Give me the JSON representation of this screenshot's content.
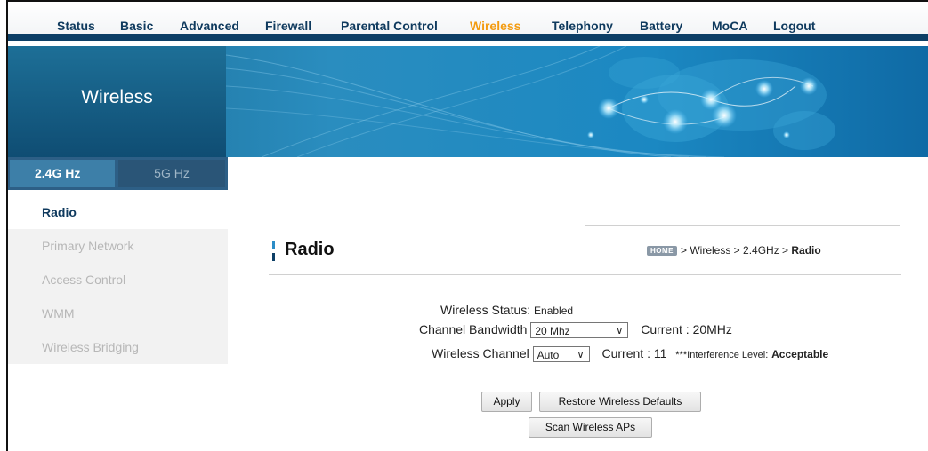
{
  "nav": {
    "items": [
      "Status",
      "Basic",
      "Advanced",
      "Firewall",
      "Parental Control",
      "Wireless",
      "Telephony",
      "Battery",
      "MoCA",
      "Logout"
    ],
    "active": "Wireless",
    "active_color": "#f39c12",
    "link_color": "#0f3a5e"
  },
  "banner": {
    "title": "Wireless"
  },
  "band_tabs": {
    "tab1": "2.4G Hz",
    "tab2": "5G Hz"
  },
  "sidebar": {
    "items": [
      {
        "label": "Radio"
      },
      {
        "label": "Primary Network"
      },
      {
        "label": "Access Control"
      },
      {
        "label": "WMM"
      },
      {
        "label": "Wireless Bridging"
      }
    ]
  },
  "page": {
    "title": "Radio",
    "breadcrumb": {
      "home_icon": "HOME",
      "path": "> Wireless > 2.4GHz >",
      "current": "Radio"
    }
  },
  "form": {
    "status_label": "Wireless Status:",
    "status_value": "Enabled",
    "bandwidth_label": "Channel Bandwidth",
    "bandwidth_value": "20 Mhz",
    "bandwidth_current_label": "Current :",
    "bandwidth_current_value": "20MHz",
    "channel_label": "Wireless Channel",
    "channel_value": "Auto",
    "channel_current_label": "Current :",
    "channel_current_value": "11",
    "interference_label": "***Interference Level:",
    "interference_value": "Acceptable"
  },
  "buttons": {
    "apply": "Apply",
    "restore": "Restore Wireless Defaults",
    "scan": "Scan Wireless APs"
  },
  "colors": {
    "primary": "#0d3f66",
    "accent": "#2b8dc7",
    "banner": "#1b88c2"
  }
}
